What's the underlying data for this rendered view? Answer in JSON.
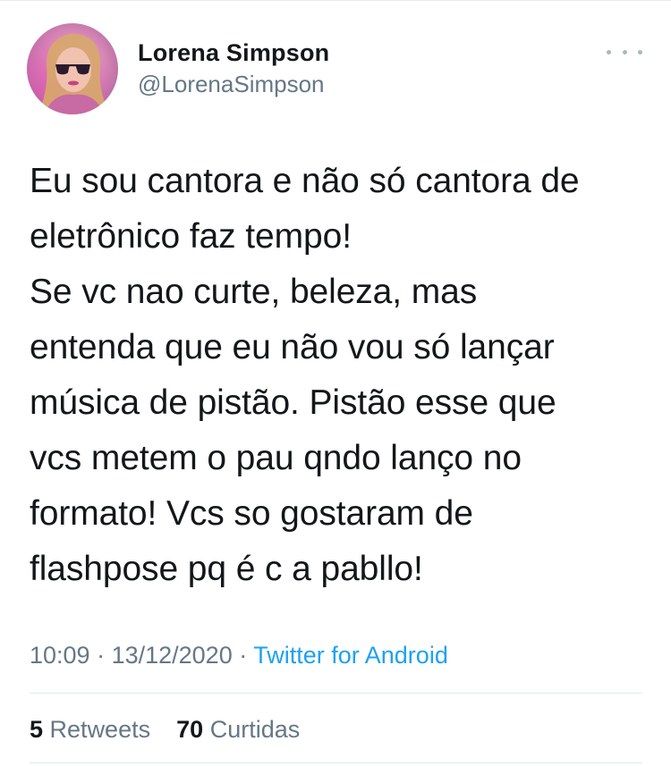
{
  "tweet": {
    "author": {
      "display_name": "Lorena Simpson",
      "handle": "@LorenaSimpson",
      "avatar_icon": "profile-photo"
    },
    "more_icon": "more-options-icon",
    "text": "Eu sou cantora e não só cantora de\neletrônico faz tempo!\nSe vc nao curte, beleza, mas\nentenda que eu não vou só lançar\nmúsica de pistão. Pistão esse que\nvcs metem o pau qndo lanço no\nformato! Vcs so gostaram de\nflashpose pq é c a pabllo!",
    "meta": {
      "time": "10:09",
      "sep1": " · ",
      "date": "13/12/2020",
      "sep2": " · ",
      "source": "Twitter for Android"
    },
    "stats": {
      "retweets_count": "5",
      "retweets_label": "Retweets",
      "likes_count": "70",
      "likes_label": "Curtidas"
    }
  },
  "colors": {
    "text_primary": "#14171a",
    "text_secondary": "#657786",
    "link": "#1da1f2",
    "divider": "#e1e8ed"
  }
}
